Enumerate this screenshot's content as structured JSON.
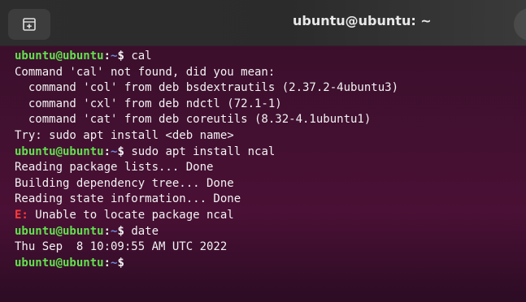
{
  "window": {
    "title": "ubuntu@ubuntu: ~"
  },
  "terminal": {
    "lines": [
      {
        "type": "prompt",
        "user": "ubuntu@ubuntu",
        "colon": ":",
        "path": "~",
        "dollar": "$ ",
        "cmd": "cal"
      },
      {
        "type": "out",
        "text": "Command 'cal' not found, did you mean:"
      },
      {
        "type": "out",
        "text": "  command 'col' from deb bsdextrautils (2.37.2-4ubuntu3)"
      },
      {
        "type": "out",
        "text": "  command 'cxl' from deb ndctl (72.1-1)"
      },
      {
        "type": "out",
        "text": "  command 'cat' from deb coreutils (8.32-4.1ubuntu1)"
      },
      {
        "type": "out",
        "text": "Try: sudo apt install <deb name>"
      },
      {
        "type": "prompt",
        "user": "ubuntu@ubuntu",
        "colon": ":",
        "path": "~",
        "dollar": "$ ",
        "cmd": "sudo apt install ncal"
      },
      {
        "type": "out",
        "text": "Reading package lists... Done"
      },
      {
        "type": "out",
        "text": "Building dependency tree... Done"
      },
      {
        "type": "out",
        "text": "Reading state information... Done"
      },
      {
        "type": "error",
        "prefix": "E:",
        "text": " Unable to locate package ncal"
      },
      {
        "type": "prompt",
        "user": "ubuntu@ubuntu",
        "colon": ":",
        "path": "~",
        "dollar": "$ ",
        "cmd": "date"
      },
      {
        "type": "out",
        "text": "Thu Sep  8 10:09:55 AM UTC 2022"
      },
      {
        "type": "prompt",
        "user": "ubuntu@ubuntu",
        "colon": ":",
        "path": "~",
        "dollar": "$",
        "cmd": ""
      }
    ]
  },
  "colors": {
    "prompt_user": "#62e14e",
    "prompt_path": "#6b8bd8",
    "error": "#ff3b3b",
    "terminal_bg": "#4a1035",
    "titlebar_bg": "#2d2d2d"
  },
  "icons": {
    "new_tab": "new-tab-icon",
    "menu": "menu-icon"
  }
}
